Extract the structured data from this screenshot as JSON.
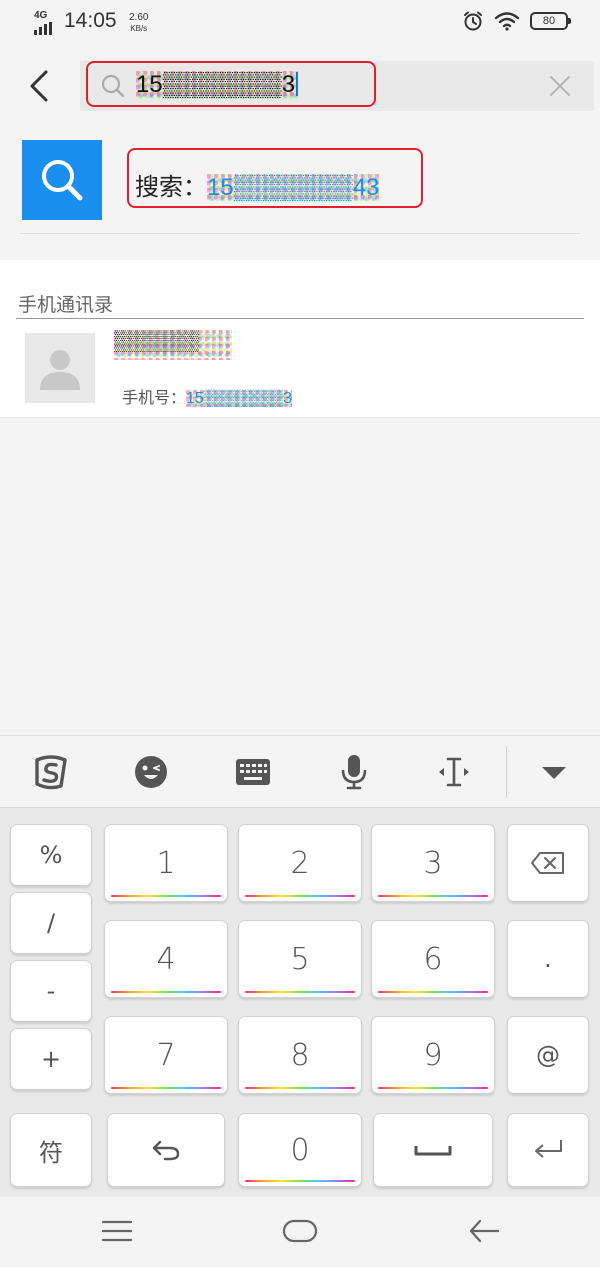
{
  "status_bar": {
    "network": "4G",
    "time": "14:05",
    "speed_value": "2.60",
    "speed_unit": "KB/s",
    "battery": "80",
    "icons": [
      "alarm-icon",
      "wifi-icon",
      "battery-icon"
    ]
  },
  "search": {
    "query": "15▒▒▒▒▒▒▒3",
    "icons": [
      "back-arrow-icon",
      "search-icon",
      "clear-icon"
    ]
  },
  "suggestion": {
    "label": "搜索：",
    "number": "15▒▒▒▒▒▒▒43",
    "accent_color": "#1a8ff0"
  },
  "contacts": {
    "section_title": "手机通讯录",
    "items": [
      {
        "name": "▒▒▒▒▒▒",
        "phone_label": "手机号：",
        "phone": "15▒▒▒▒▒▒▒3"
      }
    ]
  },
  "keyboard": {
    "toolbar_icons": [
      "sogou-logo-icon",
      "emoji-icon",
      "keyboard-icon",
      "microphone-icon",
      "cursor-move-icon",
      "collapse-icon"
    ],
    "symbol_keys": [
      "%",
      "/",
      "-",
      "+"
    ],
    "digit_keys": [
      "1",
      "2",
      "3",
      "4",
      "5",
      "6",
      "7",
      "8",
      "9"
    ],
    "right_keys": [
      ".",
      "@"
    ],
    "bottom_row": {
      "symbols_label": "符",
      "zero": "0"
    }
  },
  "nav_bar": {
    "icons": [
      "menu-icon",
      "home-icon",
      "back-icon"
    ]
  },
  "colors": {
    "highlight_border": "#e0202a",
    "brand_blue": "#1a8ff0"
  }
}
